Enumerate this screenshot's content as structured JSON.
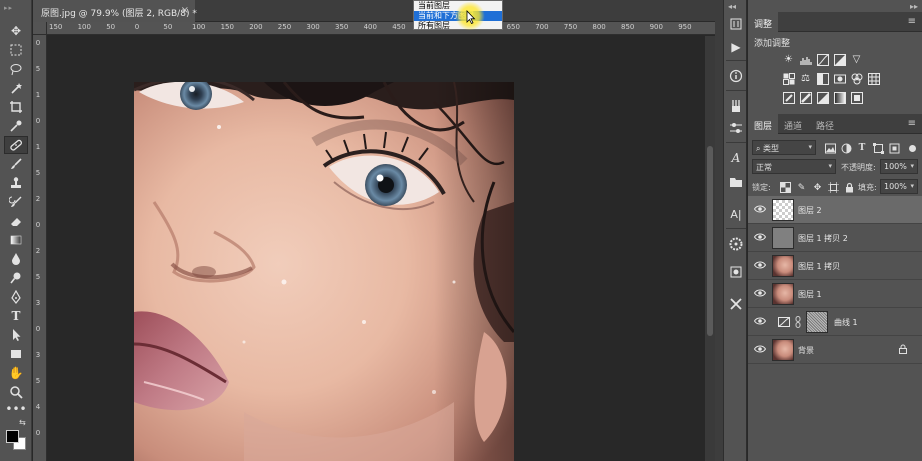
{
  "document": {
    "tab_title": "原图.jpg @ 79.9% (图层 2, RGB/8) *",
    "close": "×"
  },
  "rulers": {
    "horizontal": [
      "150",
      "100",
      "50",
      "0",
      "50",
      "100",
      "150",
      "200",
      "250",
      "300",
      "350",
      "400",
      "450",
      "500",
      "550",
      "600",
      "650",
      "700",
      "750",
      "800",
      "850",
      "900",
      "950"
    ],
    "vertical": [
      "0",
      "5",
      "1",
      "0",
      "1",
      "5",
      "2",
      "0",
      "2",
      "5",
      "3",
      "0",
      "3",
      "5",
      "4",
      "0"
    ]
  },
  "sample_popup": {
    "options": [
      "当前图层",
      "当前和下方图层",
      "所有图层"
    ],
    "selected_index": 1
  },
  "panels": {
    "adjustments": {
      "tab_label": "调整",
      "title": "添加调整"
    },
    "layers_panel": {
      "tabs": [
        "图层",
        "通道",
        "路径"
      ],
      "filter_kind": "类型",
      "blend_mode": "正常",
      "opacity_label": "不透明度:",
      "opacity_value": "100%",
      "lock_label": "锁定:",
      "fill_label": "填充:",
      "fill_value": "100%",
      "menu": "≡"
    }
  },
  "layers": [
    {
      "name": "图层 2",
      "thumb": "transparent",
      "selected": true
    },
    {
      "name": "图层 1 拷贝 2",
      "thumb": "gray",
      "selected": false
    },
    {
      "name": "图层 1 拷贝",
      "thumb": "face",
      "selected": false
    },
    {
      "name": "图层 1",
      "thumb": "face",
      "selected": false
    },
    {
      "name": "曲线 1",
      "thumb": "adjustment",
      "selected": false
    },
    {
      "name": "背景",
      "thumb": "face",
      "selected": false,
      "locked": true
    }
  ],
  "colors": {
    "ui_panel": "#535353",
    "workspace": "#282828",
    "selection_highlight": "#1f6fd6"
  }
}
